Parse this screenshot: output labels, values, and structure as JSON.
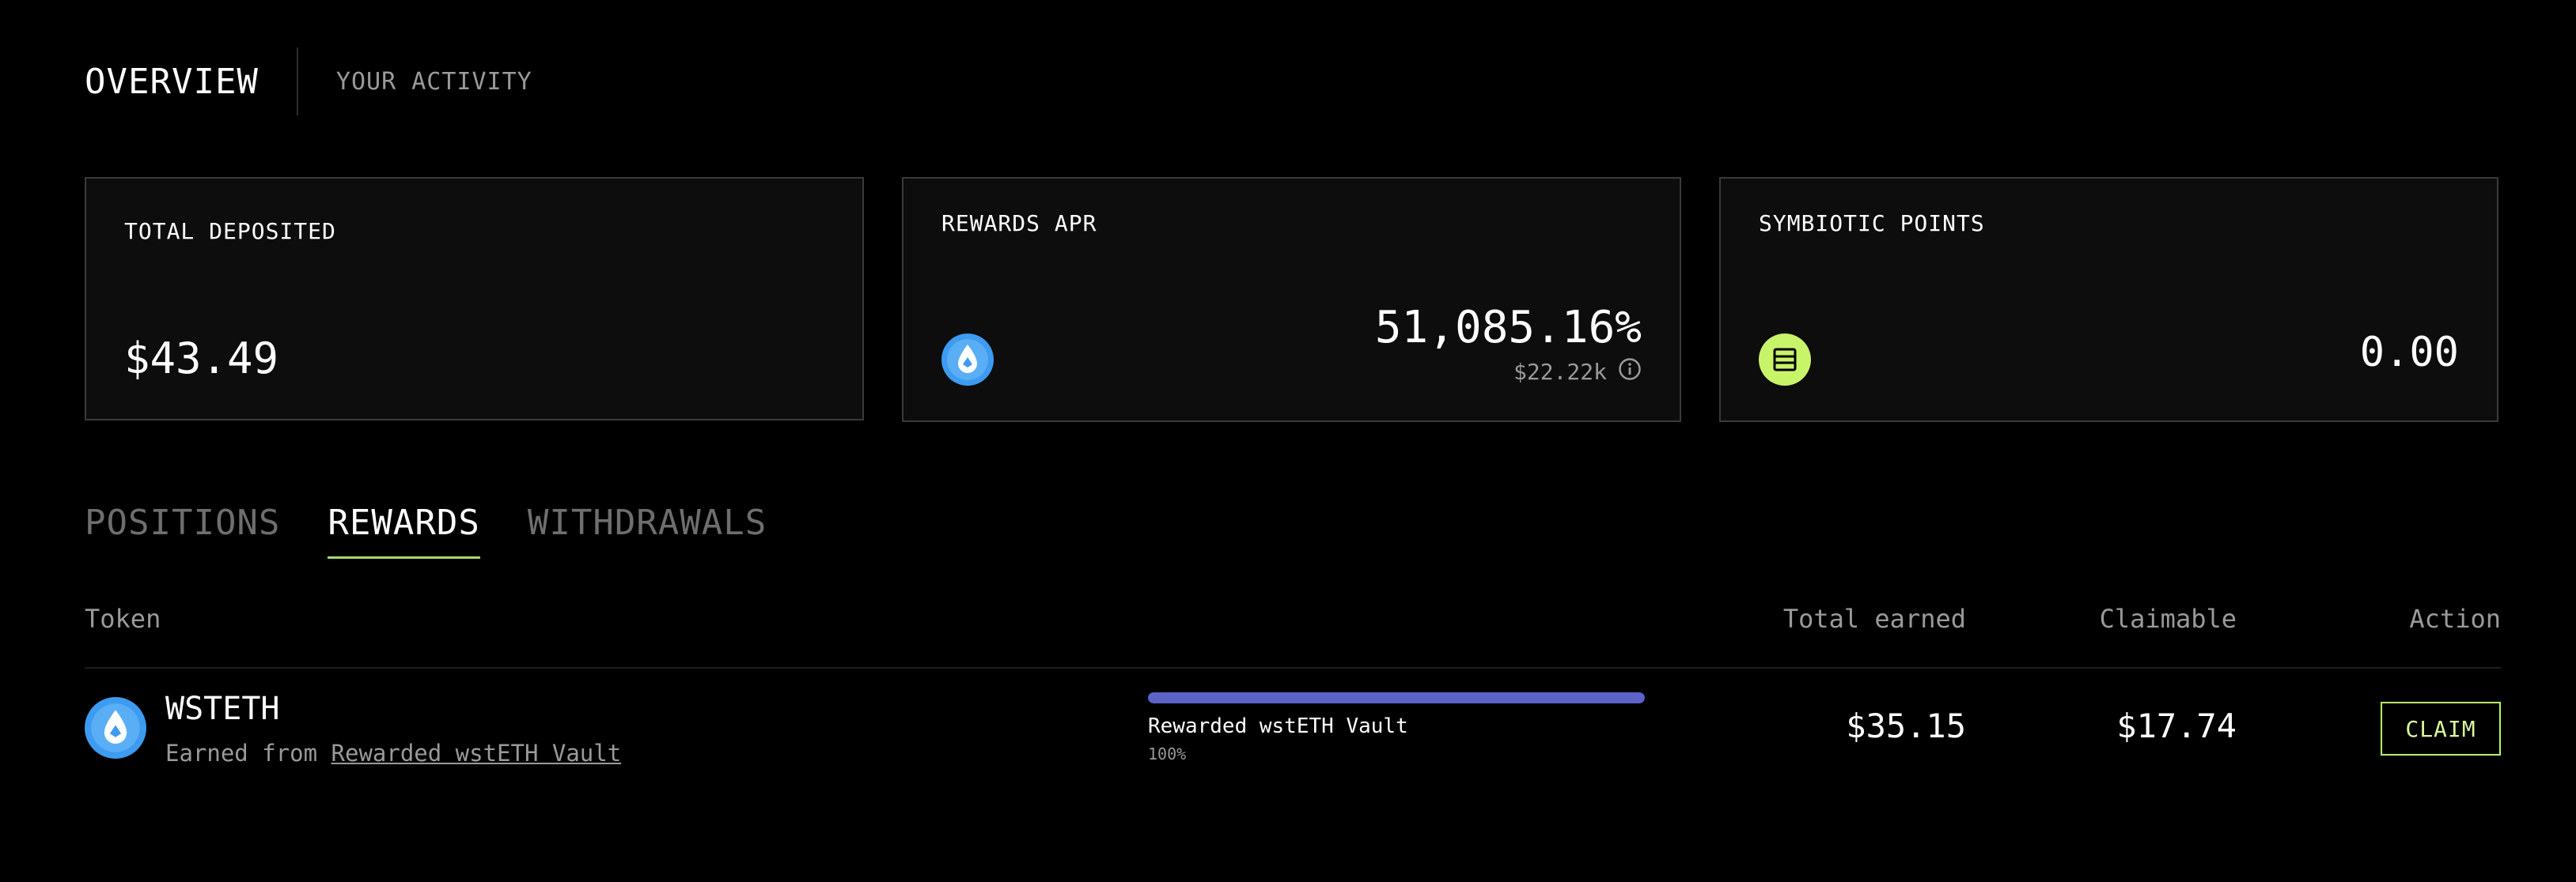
{
  "header": {
    "title": "OVERVIEW",
    "activity_tab": "YOUR ACTIVITY"
  },
  "cards": {
    "total_deposited": {
      "label": "TOTAL DEPOSITED",
      "value": "$43.49"
    },
    "rewards_apr": {
      "label": "REWARDS APR",
      "value": "51,085.16%",
      "sub_value": "$22.22k",
      "icon": "wsteth-drop-icon",
      "info_icon": "info-icon"
    },
    "symbiotic_points": {
      "label": "SYMBIOTIC POINTS",
      "value": "0.00",
      "icon": "symbiotic-icon"
    }
  },
  "tabs": [
    {
      "label": "POSITIONS",
      "active": false
    },
    {
      "label": "REWARDS",
      "active": true
    },
    {
      "label": "WITHDRAWALS",
      "active": false
    }
  ],
  "table": {
    "columns": {
      "token": "Token",
      "total_earned": "Total earned",
      "claimable": "Claimable",
      "action": "Action"
    },
    "rows": [
      {
        "token": "WSTETH",
        "earned_prefix": "Earned from",
        "earned_link": "Rewarded wstETH Vault",
        "vault_name": "Rewarded wstETH Vault",
        "vault_share": "100%",
        "vault_share_fraction": 1.0,
        "total_earned": "$35.15",
        "claimable": "$17.74",
        "action": "CLAIM"
      }
    ]
  },
  "colors": {
    "background": "#000000",
    "card_bg": "#0d0d0d",
    "card_border": "#3a3a3a",
    "muted_text": "#9a9a9a",
    "accent_green": "#b9f46a",
    "tab_underline": "#a6d96a",
    "progress_fill": "#5b63c9",
    "wsteth_blue": "#3d9bf0"
  }
}
